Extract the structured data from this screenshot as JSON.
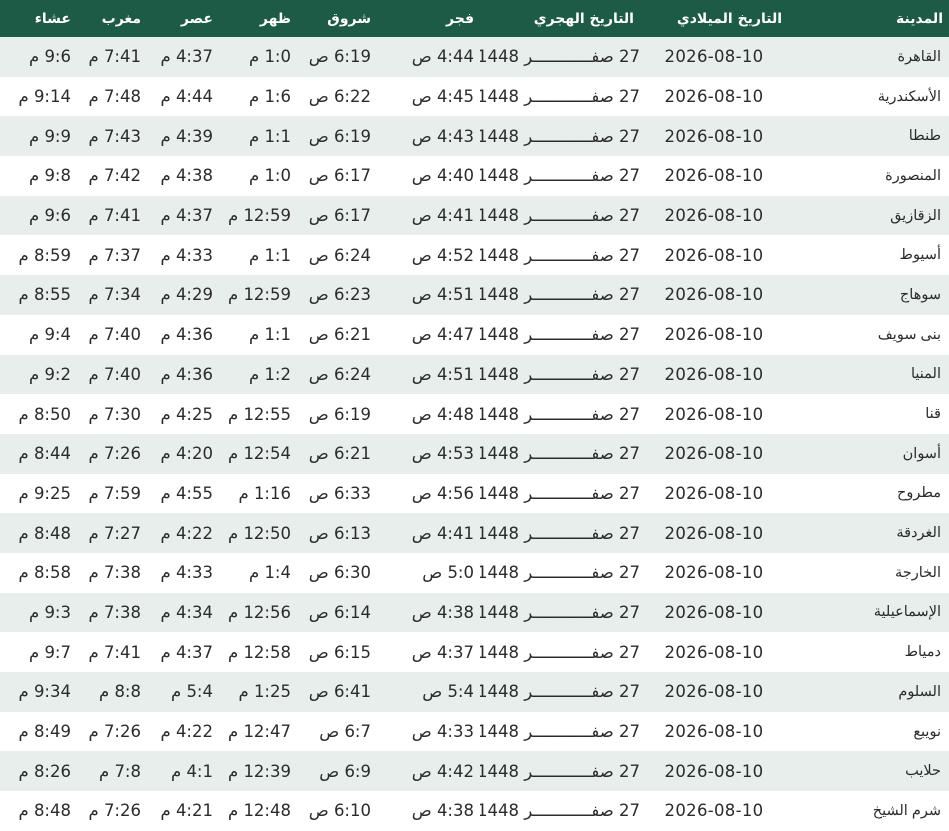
{
  "columns": {
    "city": "المدينة",
    "gregorian": "التاريخ الميلادي",
    "hijri": "التاريخ الهجري",
    "fajr": "فجر",
    "sunrise": "شروق",
    "dhuhr": "ظهر",
    "asr": "عصر",
    "maghrib": "مغرب",
    "isha": "عشاء"
  },
  "rows": [
    {
      "city": "القاهرة",
      "gregorian": "2026-08-10",
      "hijri": "27 صفــــــــــــر 1448",
      "fajr": "4:44 ص",
      "sunrise": "6:19 ص",
      "dhuhr": "1:0 م",
      "asr": "4:37 م",
      "maghrib": "7:41 م",
      "isha": "9:6 م"
    },
    {
      "city": "الأسكندرية",
      "gregorian": "2026-08-10",
      "hijri": "27 صفــــــــــــر 1448",
      "fajr": "4:45 ص",
      "sunrise": "6:22 ص",
      "dhuhr": "1:6 م",
      "asr": "4:44 م",
      "maghrib": "7:48 م",
      "isha": "9:14 م"
    },
    {
      "city": "طنطا",
      "gregorian": "2026-08-10",
      "hijri": "27 صفــــــــــــر 1448",
      "fajr": "4:43 ص",
      "sunrise": "6:19 ص",
      "dhuhr": "1:1 م",
      "asr": "4:39 م",
      "maghrib": "7:43 م",
      "isha": "9:9 م"
    },
    {
      "city": "المنصورة",
      "gregorian": "2026-08-10",
      "hijri": "27 صفــــــــــــر 1448",
      "fajr": "4:40 ص",
      "sunrise": "6:17 ص",
      "dhuhr": "1:0 م",
      "asr": "4:38 م",
      "maghrib": "7:42 م",
      "isha": "9:8 م"
    },
    {
      "city": "الزقازيق",
      "gregorian": "2026-08-10",
      "hijri": "27 صفــــــــــــر 1448",
      "fajr": "4:41 ص",
      "sunrise": "6:17 ص",
      "dhuhr": "12:59 م",
      "asr": "4:37 م",
      "maghrib": "7:41 م",
      "isha": "9:6 م"
    },
    {
      "city": "أسيوط",
      "gregorian": "2026-08-10",
      "hijri": "27 صفــــــــــــر 1448",
      "fajr": "4:52 ص",
      "sunrise": "6:24 ص",
      "dhuhr": "1:1 م",
      "asr": "4:33 م",
      "maghrib": "7:37 م",
      "isha": "8:59 م"
    },
    {
      "city": "سوهاج",
      "gregorian": "2026-08-10",
      "hijri": "27 صفــــــــــــر 1448",
      "fajr": "4:51 ص",
      "sunrise": "6:23 ص",
      "dhuhr": "12:59 م",
      "asr": "4:29 م",
      "maghrib": "7:34 م",
      "isha": "8:55 م"
    },
    {
      "city": "بنى سويف",
      "gregorian": "2026-08-10",
      "hijri": "27 صفــــــــــــر 1448",
      "fajr": "4:47 ص",
      "sunrise": "6:21 ص",
      "dhuhr": "1:1 م",
      "asr": "4:36 م",
      "maghrib": "7:40 م",
      "isha": "9:4 م"
    },
    {
      "city": "المنيا",
      "gregorian": "2026-08-10",
      "hijri": "27 صفــــــــــــر 1448",
      "fajr": "4:51 ص",
      "sunrise": "6:24 ص",
      "dhuhr": "1:2 م",
      "asr": "4:36 م",
      "maghrib": "7:40 م",
      "isha": "9:2 م"
    },
    {
      "city": "قنا",
      "gregorian": "2026-08-10",
      "hijri": "27 صفــــــــــــر 1448",
      "fajr": "4:48 ص",
      "sunrise": "6:19 ص",
      "dhuhr": "12:55 م",
      "asr": "4:25 م",
      "maghrib": "7:30 م",
      "isha": "8:50 م"
    },
    {
      "city": "أسوان",
      "gregorian": "2026-08-10",
      "hijri": "27 صفــــــــــــر 1448",
      "fajr": "4:53 ص",
      "sunrise": "6:21 ص",
      "dhuhr": "12:54 م",
      "asr": "4:20 م",
      "maghrib": "7:26 م",
      "isha": "8:44 م"
    },
    {
      "city": "مطروح",
      "gregorian": "2026-08-10",
      "hijri": "27 صفــــــــــــر 1448",
      "fajr": "4:56 ص",
      "sunrise": "6:33 ص",
      "dhuhr": "1:16 م",
      "asr": "4:55 م",
      "maghrib": "7:59 م",
      "isha": "9:25 م"
    },
    {
      "city": "الغردقة",
      "gregorian": "2026-08-10",
      "hijri": "27 صفــــــــــــر 1448",
      "fajr": "4:41 ص",
      "sunrise": "6:13 ص",
      "dhuhr": "12:50 م",
      "asr": "4:22 م",
      "maghrib": "7:27 م",
      "isha": "8:48 م"
    },
    {
      "city": "الخارجة",
      "gregorian": "2026-08-10",
      "hijri": "27 صفــــــــــــر 1448",
      "fajr": "5:0 ص",
      "sunrise": "6:30 ص",
      "dhuhr": "1:4 م",
      "asr": "4:33 م",
      "maghrib": "7:38 م",
      "isha": "8:58 م"
    },
    {
      "city": "الإسماعيلية",
      "gregorian": "2026-08-10",
      "hijri": "27 صفــــــــــــر 1448",
      "fajr": "4:38 ص",
      "sunrise": "6:14 ص",
      "dhuhr": "12:56 م",
      "asr": "4:34 م",
      "maghrib": "7:38 م",
      "isha": "9:3 م"
    },
    {
      "city": "دمياط",
      "gregorian": "2026-08-10",
      "hijri": "27 صفــــــــــــر 1448",
      "fajr": "4:37 ص",
      "sunrise": "6:15 ص",
      "dhuhr": "12:58 م",
      "asr": "4:37 م",
      "maghrib": "7:41 م",
      "isha": "9:7 م"
    },
    {
      "city": "السلوم",
      "gregorian": "2026-08-10",
      "hijri": "27 صفــــــــــــر 1448",
      "fajr": "5:4 ص",
      "sunrise": "6:41 ص",
      "dhuhr": "1:25 م",
      "asr": "5:4 م",
      "maghrib": "8:8 م",
      "isha": "9:34 م"
    },
    {
      "city": "نويبع",
      "gregorian": "2026-08-10",
      "hijri": "27 صفــــــــــــر 1448",
      "fajr": "4:33 ص",
      "sunrise": "6:7 ص",
      "dhuhr": "12:47 م",
      "asr": "4:22 م",
      "maghrib": "7:26 م",
      "isha": "8:49 م"
    },
    {
      "city": "حلايب",
      "gregorian": "2026-08-10",
      "hijri": "27 صفــــــــــــر 1448",
      "fajr": "4:42 ص",
      "sunrise": "6:9 ص",
      "dhuhr": "12:39 م",
      "asr": "4:1 م",
      "maghrib": "7:8 م",
      "isha": "8:26 م"
    },
    {
      "city": "شرم الشيخ",
      "gregorian": "2026-08-10",
      "hijri": "27 صفــــــــــــر 1448",
      "fajr": "4:38 ص",
      "sunrise": "6:10 ص",
      "dhuhr": "12:48 م",
      "asr": "4:21 م",
      "maghrib": "7:26 م",
      "isha": "8:48 م"
    }
  ]
}
